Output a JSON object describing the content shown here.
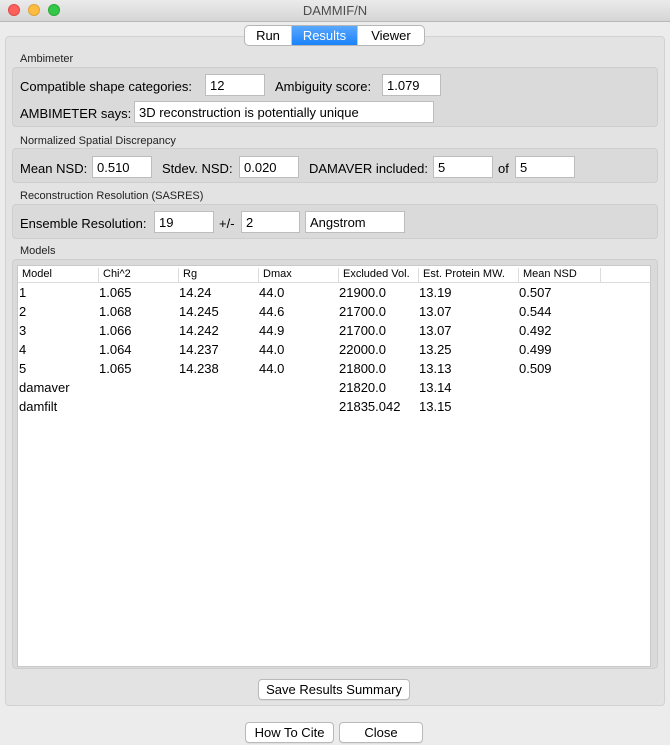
{
  "window": {
    "title": "DAMMIF/N"
  },
  "tabs": {
    "run": "Run",
    "results": "Results",
    "viewer": "Viewer"
  },
  "ambimeter": {
    "section": "Ambimeter",
    "categories_label": "Compatible shape categories:",
    "categories_value": "12",
    "ambiguity_label": "Ambiguity score:",
    "ambiguity_value": "1.079",
    "says_label": "AMBIMETER says:",
    "says_value": "3D reconstruction is potentially unique"
  },
  "nsd": {
    "section": "Normalized Spatial Discrepancy",
    "mean_label": "Mean NSD:",
    "mean_value": "0.510",
    "stdev_label": "Stdev. NSD:",
    "stdev_value": "0.020",
    "damaver_label": "DAMAVER included:",
    "damaver_value": "5",
    "of_label": "of",
    "of_value": "5"
  },
  "sasres": {
    "section": "Reconstruction Resolution (SASRES)",
    "ensemble_label": "Ensemble Resolution:",
    "ensemble_value": "19",
    "pm_label": "+/-",
    "pm_value": "2",
    "unit_value": "Angstrom"
  },
  "models": {
    "section": "Models",
    "columns": [
      "Model",
      "Chi^2",
      "Rg",
      "Dmax",
      "Excluded Vol.",
      "Est. Protein MW.",
      "Mean NSD"
    ],
    "rows": [
      [
        "1",
        "1.065",
        "14.24",
        "44.0",
        "21900.0",
        "13.19",
        "0.507"
      ],
      [
        "2",
        "1.068",
        "14.245",
        "44.6",
        "21700.0",
        "13.07",
        "0.544"
      ],
      [
        "3",
        "1.066",
        "14.242",
        "44.9",
        "21700.0",
        "13.07",
        "0.492"
      ],
      [
        "4",
        "1.064",
        "14.237",
        "44.0",
        "22000.0",
        "13.25",
        "0.499"
      ],
      [
        "5",
        "1.065",
        "14.238",
        "44.0",
        "21800.0",
        "13.13",
        "0.509"
      ],
      [
        "damaver",
        "",
        "",
        "",
        "21820.0",
        "13.14",
        ""
      ],
      [
        "damfilt",
        "",
        "",
        "",
        "21835.042",
        "13.15",
        ""
      ]
    ]
  },
  "buttons": {
    "save_summary": "Save Results Summary",
    "how_to_cite": "How To Cite",
    "close": "Close"
  },
  "colors": {
    "accent": "#1a82fb",
    "window_bg": "#ececec"
  }
}
